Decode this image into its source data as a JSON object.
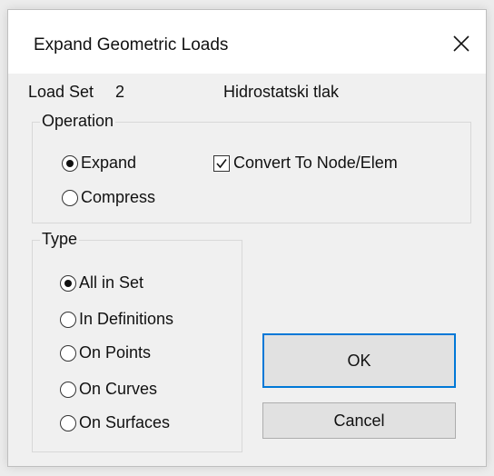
{
  "dialog": {
    "title": "Expand Geometric Loads",
    "close_icon": "close-icon"
  },
  "load_set": {
    "label": "Load Set",
    "number": "2",
    "name": "Hidrostatski tlak"
  },
  "operation": {
    "legend": "Operation",
    "options": [
      {
        "label": "Expand",
        "checked": true
      },
      {
        "label": "Compress",
        "checked": false
      }
    ],
    "convert_checkbox": {
      "label": "Convert To Node/Elem",
      "checked": true
    }
  },
  "type": {
    "legend": "Type",
    "options": [
      {
        "label": "All in Set",
        "checked": true
      },
      {
        "label": "In Definitions",
        "checked": false
      },
      {
        "label": "On Points",
        "checked": false
      },
      {
        "label": "On Curves",
        "checked": false
      },
      {
        "label": "On Surfaces",
        "checked": false
      }
    ]
  },
  "buttons": {
    "ok": "OK",
    "cancel": "Cancel"
  },
  "colors": {
    "accent": "#0078d7",
    "dialog_bg": "#f0f0f0",
    "button_bg": "#e1e1e1"
  }
}
